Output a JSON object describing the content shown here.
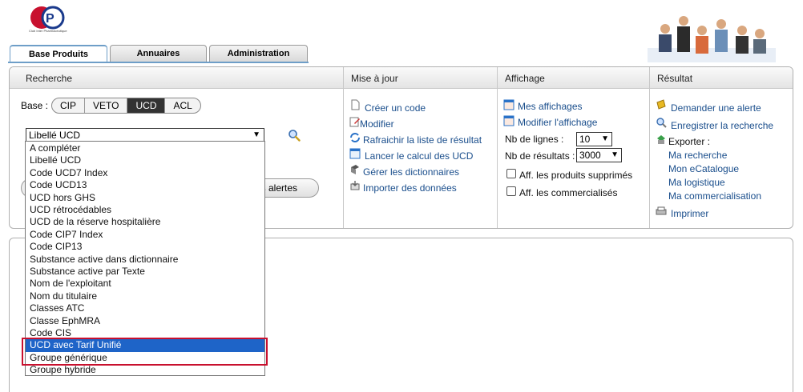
{
  "header": {
    "logo_caption": "Club Inter Pharmaceutique"
  },
  "tabs": [
    {
      "label": "Base Produits",
      "active": true
    },
    {
      "label": "Annuaires",
      "active": false
    },
    {
      "label": "Administration",
      "active": false
    }
  ],
  "recherche": {
    "title": "Recherche",
    "base_label": "Base :",
    "bases": [
      "CIP",
      "VETO",
      "UCD",
      "ACL"
    ],
    "selected_base": "UCD",
    "criteria_selected": "Libellé UCD",
    "alerts_button": "es alertes",
    "criteria_options": [
      "A compléter",
      "Libellé UCD",
      "Code UCD7 Index",
      "Code UCD13",
      "UCD hors GHS",
      "UCD rétrocédables",
      "UCD de la réserve hospitalière",
      "Code CIP7 Index",
      "Code CIP13",
      "Substance active dans dictionnaire",
      "Substance active par Texte",
      "Nom de l'exploitant",
      "Nom du titulaire",
      "Classes ATC",
      "Classe EphMRA",
      "Code CIS",
      "UCD avec Tarif Unifié",
      "Groupe générique",
      "Groupe hybride"
    ],
    "highlighted_option": "UCD avec Tarif Unifié"
  },
  "mise_a_jour": {
    "title": "Mise à jour",
    "links": [
      "Créer un code",
      "Modifier",
      "Rafraichir la liste de résultat",
      "Lancer le calcul des UCD",
      "Gérer les dictionnaires",
      "Importer des données"
    ]
  },
  "affichage": {
    "title": "Affichage",
    "links": [
      "Mes affichages",
      "Modifier l'affichage"
    ],
    "nb_lignes_label": "Nb de lignes :",
    "nb_lignes_value": "10",
    "nb_resultats_label": "Nb de résultats :",
    "nb_resultats_value": "3000",
    "checkboxes": [
      "Aff. les produits supprimés",
      "Aff. les commercialisés"
    ]
  },
  "resultat": {
    "title": "Résultat",
    "demander_alerte": "Demander une alerte",
    "enregistrer": "Enregistrer la recherche",
    "exporter_label": "Exporter :",
    "export_links": [
      "Ma recherche",
      "Mon eCatalogue",
      "Ma logistique",
      "Ma commercialisation"
    ],
    "imprimer": "Imprimer"
  },
  "colors": {
    "accent": "#6e9ec8",
    "link": "#1a4e8c",
    "highlight": "#1e64c8",
    "callout": "#c8102e"
  }
}
